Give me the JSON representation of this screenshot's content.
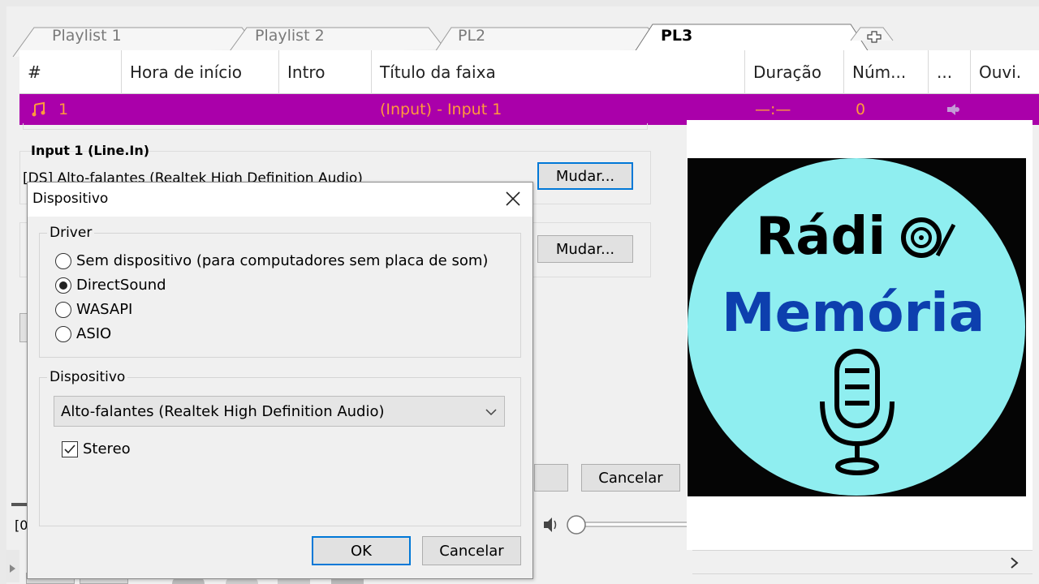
{
  "tabs": [
    "Playlist 1",
    "Playlist 2",
    "PL2",
    "PL3"
  ],
  "columns": [
    "#",
    "Hora de início",
    "Intro",
    "Título da faixa",
    "Duração",
    "Núm...",
    "...",
    "Ouvi."
  ],
  "selected_row": {
    "num": "1",
    "title": "(Input) - Input 1",
    "duration": "—:—",
    "count": "0"
  },
  "panel": {
    "input_title": "Input 1 (Line.In)",
    "input_device": "[DS] Alto-falantes (Realtek High Definition Audio)",
    "mudar1": "Mudar...",
    "mudar2": "Mudar...",
    "cancel": "Cancelar",
    "status_prefix": "[0("
  },
  "dialog": {
    "title": "Dispositivo",
    "driver_legend": "Driver",
    "drivers": [
      "Sem dispositivo (para computadores sem placa de som)",
      "DirectSound",
      "WASAPI",
      "ASIO"
    ],
    "selected_driver": "DirectSound",
    "device_legend": "Dispositivo",
    "device_value": "Alto-falantes (Realtek High Definition Audio)",
    "stereo_label": "Stereo",
    "stereo_checked": true,
    "ok": "OK",
    "cancel": "Cancelar"
  },
  "logo": {
    "line1": "Rádi",
    "line2": "Memória",
    "colors": {
      "circle": "#8feef0",
      "line1": "#000000",
      "line2": "#0d3fae"
    }
  },
  "colors": {
    "row_bg": "#aa00aa",
    "row_text": "#ff9a3c",
    "focus": "#0078d7"
  }
}
